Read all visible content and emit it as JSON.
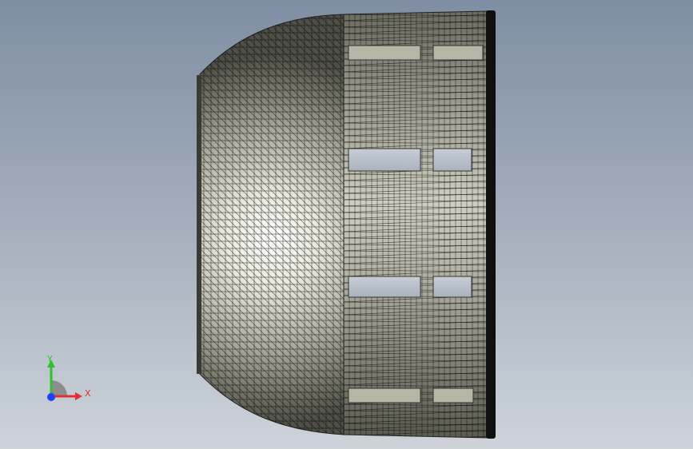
{
  "viewport": {
    "background_top": "#7f8ea3",
    "background_bottom": "#cdd3d9"
  },
  "model": {
    "type": "meshed-shell",
    "mesh_color": "#000000",
    "surface_light": "#f4f4ea",
    "surface_dark": "#5c5c52"
  },
  "triad": {
    "x_label": "X",
    "y_label": "Y",
    "x_color": "#e03030",
    "y_color": "#30c030",
    "z_color": "#2040ff"
  }
}
